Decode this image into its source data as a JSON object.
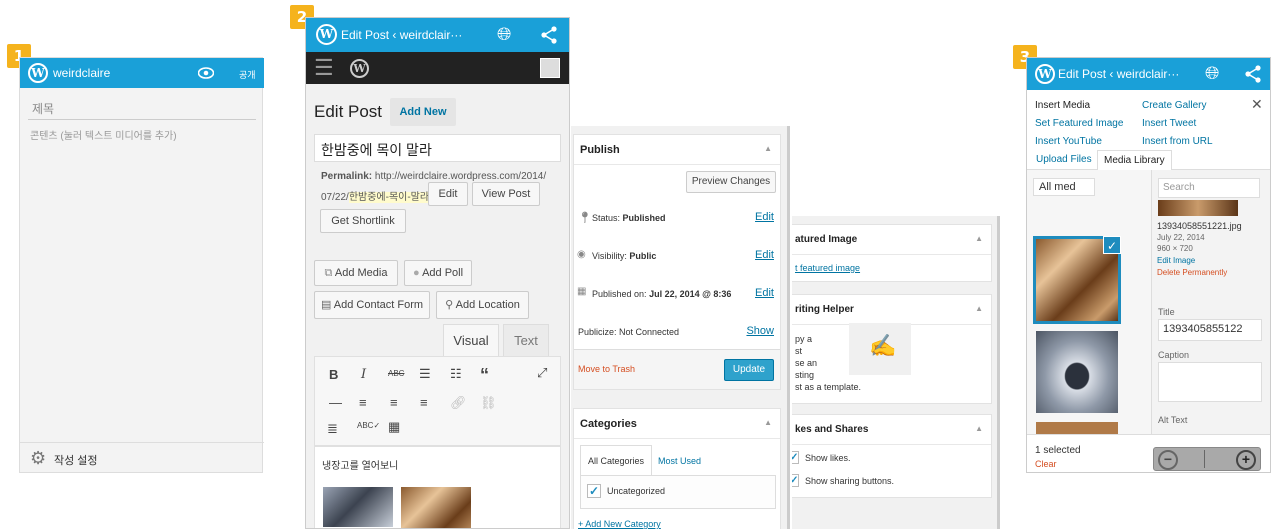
{
  "badges": [
    "1",
    "2",
    "3"
  ],
  "screen1": {
    "site": "weirdclaire",
    "eye_icon": "eye-icon",
    "publish_label": "공개",
    "title_placeholder": "제목",
    "content_placeholder": "콘텐츠 (눌러 텍스트 미디어를 추가)",
    "settings_label": "작성 설정"
  },
  "screen2": {
    "topbar_title": "Edit Post ‹ weirdclair···",
    "heading": "Edit Post",
    "add_new": "Add New",
    "post_title": "한밤중에 목이 말라",
    "permalink_label": "Permalink:",
    "permalink_url": "http://weirdclaire.wordpress.com/2014/",
    "permalink_url2": "07/22/",
    "permalink_slug": "한밤중에-목이-말라",
    "permalink_end": "/",
    "edit_btn": "Edit",
    "view_post_btn": "View Post",
    "shortlink_btn": "Get Shortlink",
    "add_media": "Add Media",
    "add_poll": "Add Poll",
    "add_contact_form": "Add Contact Form",
    "add_location": "Add Location",
    "tab_visual": "Visual",
    "tab_text": "Text",
    "content_line": "냉장고를 열어보니"
  },
  "publish_panel": {
    "title": "Publish",
    "preview": "Preview Changes",
    "status_label": "Status:",
    "status_value": "Published",
    "visibility_label": "Visibility:",
    "visibility_value": "Public",
    "published_label": "Published on:",
    "published_value": "Jul 22, 2014 @ 8:36",
    "edit": "Edit",
    "publicize": "Publicize: Not Connected",
    "show": "Show",
    "trash": "Move to Trash",
    "update": "Update"
  },
  "categories_panel": {
    "title": "Categories",
    "tab_all": "All Categories",
    "tab_used": "Most Used",
    "item": "Uncategorized",
    "add_new": "+ Add New Category"
  },
  "side_panels": {
    "featured_title": "atured Image",
    "featured_link": "t featured image",
    "helper_title": "riting Helper",
    "helper_text1": "py a",
    "helper_text2": "st",
    "helper_text3": "se an",
    "helper_text4": "sting",
    "helper_text5": "st as a template.",
    "likes_title": "kes and Shares",
    "show_likes": "Show likes.",
    "show_sharing": "Show sharing buttons."
  },
  "screen3": {
    "topbar_title": "Edit Post ‹ weirdclair···",
    "insert_media": "Insert Media",
    "create_gallery": "Create Gallery",
    "set_featured": "Set Featured Image",
    "insert_tweet": "Insert Tweet",
    "insert_youtube": "Insert YouTube",
    "insert_url": "Insert from URL",
    "tab_upload": "Upload Files",
    "tab_library": "Media Library",
    "filter": "All med",
    "search_placeholder": "Search",
    "file_name": "13934058551221.jpg",
    "file_date": "July 22, 2014",
    "file_dims": "960 × 720",
    "edit_image": "Edit Image",
    "delete": "Delete Permanently",
    "title_label": "Title",
    "title_value": "1393405855122",
    "caption_label": "Caption",
    "alt_label": "Alt Text",
    "selected": "1 selected",
    "clear": "Clear"
  },
  "colors": {
    "wp_blue": "#1aa0d8",
    "badge": "#f5b31d",
    "link": "#0074a2",
    "danger": "#d54e21",
    "update": "#2ea2cc"
  }
}
